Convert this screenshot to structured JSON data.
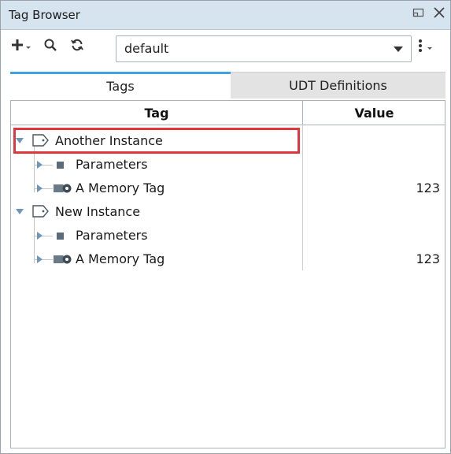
{
  "window": {
    "title": "Tag Browser"
  },
  "toolbar": {
    "provider_value": "default"
  },
  "tabs": [
    {
      "label": "Tags"
    },
    {
      "label": "UDT Definitions"
    }
  ],
  "table": {
    "columns": [
      "Tag",
      "Value"
    ],
    "rows": [
      {
        "label": "Another Instance",
        "value": ""
      },
      {
        "label": "Parameters",
        "value": ""
      },
      {
        "label": "A Memory Tag",
        "value": "123"
      },
      {
        "label": "New Instance",
        "value": ""
      },
      {
        "label": "Parameters",
        "value": ""
      },
      {
        "label": "A Memory Tag",
        "value": "123"
      }
    ]
  },
  "icons": {
    "add": "plus-icon",
    "search": "search-icon",
    "refresh": "refresh-icon",
    "menu": "kebab-menu-icon",
    "udt_instance": "tag-outline-icon",
    "folder": "square-icon",
    "memory_tag": "memory-tag-icon"
  },
  "colors": {
    "titlebar_bg": "#d6e4ef",
    "active_tab_accent": "#3ea3e0",
    "highlight_border": "#e0363e"
  }
}
